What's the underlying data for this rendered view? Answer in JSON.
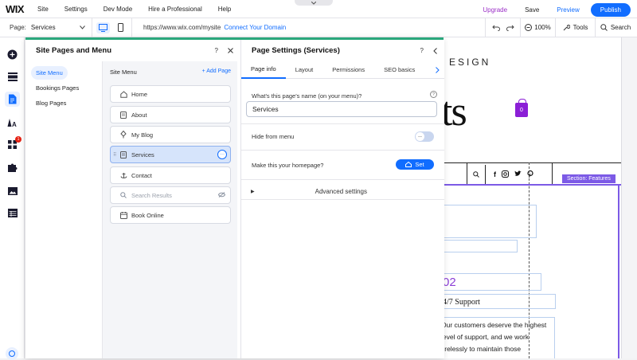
{
  "topbar": {
    "logo": "WIX",
    "menu": [
      "Site",
      "Settings",
      "Dev Mode",
      "Hire a Professional",
      "Help"
    ],
    "upgrade": "Upgrade",
    "save": "Save",
    "preview": "Preview",
    "publish": "Publish"
  },
  "secondbar": {
    "page_label": "Page:",
    "page_value": "Services",
    "url": "https://www.wix.com/mysite",
    "connect_domain": "Connect Your Domain",
    "zoom": "100%",
    "tools": "Tools",
    "search": "Search"
  },
  "rail": {
    "badge_count": "1"
  },
  "panel": {
    "title": "Site Pages and Menu",
    "help": "?",
    "leftnav": [
      "Site Menu",
      "Bookings Pages",
      "Blog Pages"
    ],
    "site_menu_heading": "Site Menu",
    "add_page": "+ Add Page",
    "pages": [
      {
        "label": "Home",
        "icon": "home-icon"
      },
      {
        "label": "About",
        "icon": "page-icon"
      },
      {
        "label": "My Blog",
        "icon": "blog-icon"
      },
      {
        "label": "Services",
        "icon": "page-icon",
        "selected": true
      },
      {
        "label": "Contact",
        "icon": "anchor-icon"
      },
      {
        "label": "Search Results",
        "icon": "search-icon",
        "hidden": true
      },
      {
        "label": "Book Online",
        "icon": "booking-icon"
      }
    ]
  },
  "settings": {
    "title": "Page Settings (Services)",
    "help": "?",
    "tabs": [
      "Page info",
      "Layout",
      "Permissions",
      "SEO basics"
    ],
    "name_question": "What's this page's name (on your menu)?",
    "name_value": "Services",
    "hide_label": "Hide from menu",
    "homepage_label": "Make this your homepage?",
    "set_button": "Set",
    "advanced": "Advanced settings"
  },
  "canvas": {
    "design_text": "ESIGN",
    "big_text": "ts",
    "cart_count": "0",
    "section_tag": "Section: Features",
    "o2_text": "02",
    "support_text": "4/7 Support",
    "paragraph": "Our customers deserve the highest level of support, and we work tirelessly to maintain those standards. When"
  },
  "colors": {
    "accent_blue": "#116dff",
    "upgrade_purple": "#9b2fc7",
    "section_purple": "#7c5ae6",
    "panel_top_green": "#2aa87c"
  }
}
